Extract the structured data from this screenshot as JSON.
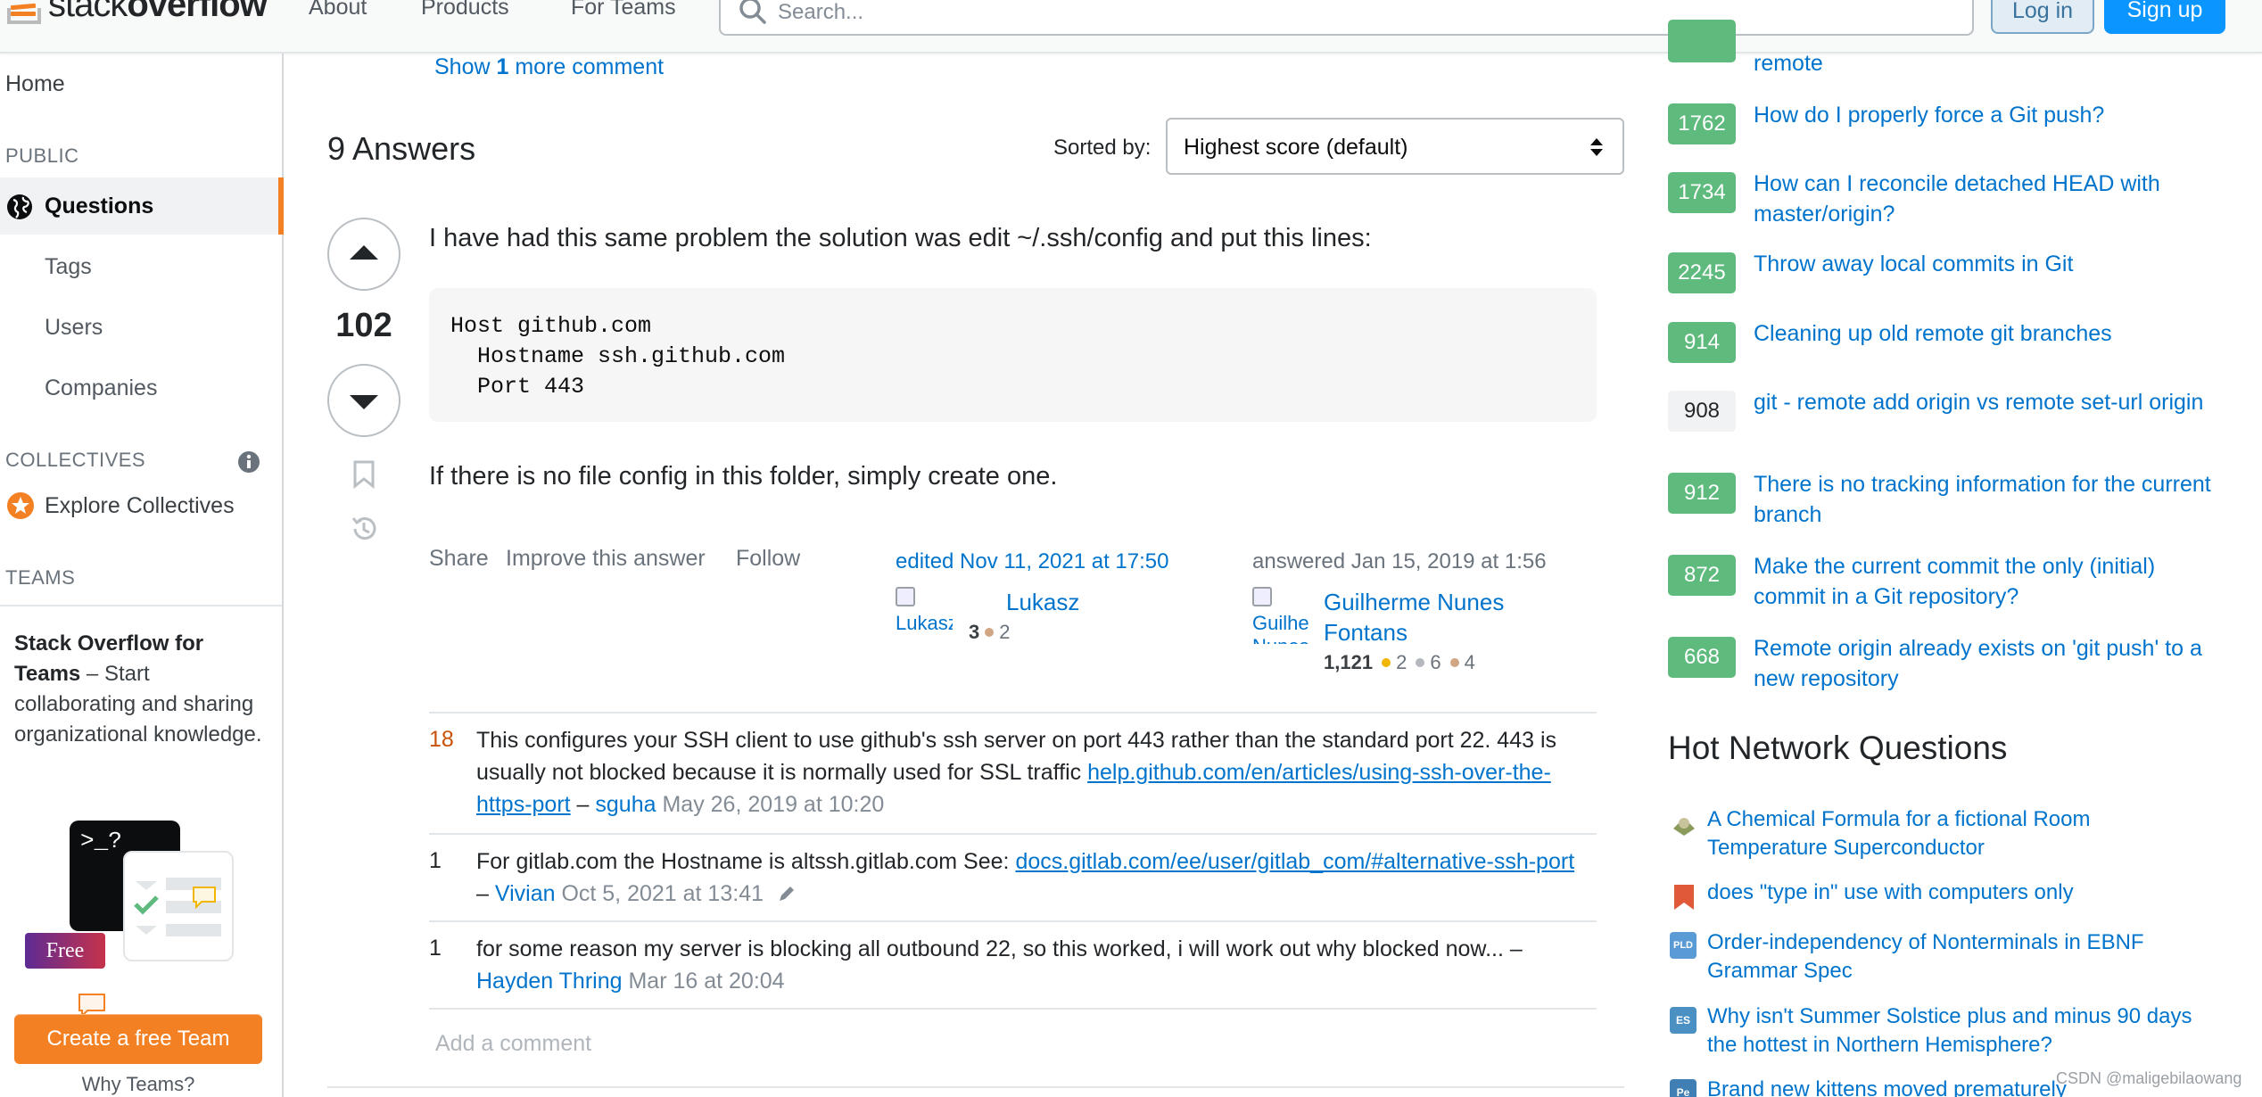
{
  "header": {
    "logo_light": "stack",
    "logo_bold": "overflow",
    "nav": [
      "About",
      "Products",
      "For Teams"
    ],
    "search_placeholder": "Search...",
    "login_label": "Log in",
    "signup_label": "Sign up"
  },
  "sidebar": {
    "home": "Home",
    "public_heading": "PUBLIC",
    "questions": "Questions",
    "tags": "Tags",
    "users": "Users",
    "companies": "Companies",
    "collectives_heading": "COLLECTIVES",
    "explore_collectives": "Explore Collectives",
    "teams_heading": "TEAMS",
    "teams_title": "Stack Overflow for Teams",
    "teams_text": " – Start collaborating and sharing organizational knowledge.",
    "free_badge": "Free",
    "terminal_text": ">_?",
    "create_team_button": "Create a free Team",
    "why_teams": "Why Teams?"
  },
  "main": {
    "show_more_prefix": "Show ",
    "show_more_count": "1",
    "show_more_suffix": " more comment",
    "answers_count_title": "9 Answers",
    "sorted_by_label": "Sorted by:",
    "sort_value": "Highest score (default)",
    "answer": {
      "score": "102",
      "intro": "I have had this same problem the solution was edit ~/.ssh/config and put this lines:",
      "code": "Host github.com\n  Hostname ssh.github.com\n  Port 443",
      "outro": "If there is no file config in this folder, simply create one.",
      "share": "Share",
      "improve": "Improve this answer",
      "follow": "Follow",
      "edited_label": "edited Nov 11, 2021 at 17:50",
      "editor_avatar_alt": "Lukasz",
      "editor_name": "Lukasz",
      "editor_rep": "3",
      "editor_bronze": "2",
      "answered_label": "answered Jan 15, 2019 at 1:56",
      "author_avatar_alt": "Guilherme Nunes Fontans",
      "author_name_line1": "Guilherme Nunes",
      "author_name_line2": "Fontans",
      "author_rep": "1,121",
      "author_gold": "2",
      "author_silver": "6",
      "author_bronze": "4"
    },
    "comments": [
      {
        "score": "18",
        "text": "This configures your SSH client to use github's ssh server on port 443 rather than the standard port 22. 443 is usually not blocked because it is normally used for SSL traffic ",
        "link": "help.github.com/en/articles/using-ssh-over-the-https-port",
        "sep": " – ",
        "user": "sguha",
        "date": " May 26, 2019 at 10:20"
      },
      {
        "score": "1",
        "text": "For gitlab.com the Hostname is altssh.gitlab.com See: ",
        "link": "docs.gitlab.com/ee/user/gitlab_com/#alternative-ssh-port",
        "sep": " – ",
        "user": "Vivian",
        "date": " Oct 5, 2021 at 13:41"
      },
      {
        "score": "1",
        "text": "for some reason my server is blocking all outbound 22, so this worked, i will work out why blocked now... – ",
        "user": "Hayden Thring",
        "date": " Mar 16 at 20:04"
      }
    ],
    "add_comment": "Add a comment"
  },
  "related": [
    {
      "score": "",
      "title": "remote",
      "style": "green"
    },
    {
      "score": "1762",
      "title": "How do I properly force a Git push?",
      "style": "green"
    },
    {
      "score": "1734",
      "title": "How can I reconcile detached HEAD with master/origin?",
      "style": "green"
    },
    {
      "score": "2245",
      "title": "Throw away local commits in Git",
      "style": "green"
    },
    {
      "score": "914",
      "title": "Cleaning up old remote git branches",
      "style": "green"
    },
    {
      "score": "908",
      "title": "git - remote add origin vs remote set-url origin",
      "style": "grey"
    },
    {
      "score": "912",
      "title": "There is no tracking information for the current branch",
      "style": "green"
    },
    {
      "score": "872",
      "title": "Make the current commit the only (initial) commit in a Git repository?",
      "style": "green"
    },
    {
      "score": "668",
      "title": "Remote origin already exists on 'git push' to a new repository",
      "style": "green"
    }
  ],
  "hot_network": {
    "title": "Hot Network Questions",
    "items": [
      {
        "title": "A Chemical Formula for a fictional Room Temperature Superconductor",
        "icon": "chemistry-icon",
        "color": "#8a9a5b",
        "icon_text": ""
      },
      {
        "title": "does \"type in\" use with computers only",
        "icon": "english-icon",
        "color": "#e05a3a",
        "icon_text": ""
      },
      {
        "title": "Order-independency of Nonterminals in EBNF Grammar Spec",
        "icon": "pld-icon",
        "color": "#5b9bd5",
        "icon_text": "PLD"
      },
      {
        "title": "Why isn't Summer Solstice plus and minus 90 days the hottest in Northern Hemisphere?",
        "icon": "earth-science-icon",
        "color": "#4a90c2",
        "icon_text": "ES"
      },
      {
        "title": "Brand new kittens moved prematurely",
        "icon": "pets-icon",
        "color": "#3f7fb3",
        "icon_text": "Pe"
      }
    ]
  },
  "watermark": "CSDN @maligebilaowang",
  "colors": {
    "accent": "#f48024",
    "link": "#0074cc",
    "accepted_green": "#5eba7d",
    "signup_blue": "#0a95ff"
  }
}
